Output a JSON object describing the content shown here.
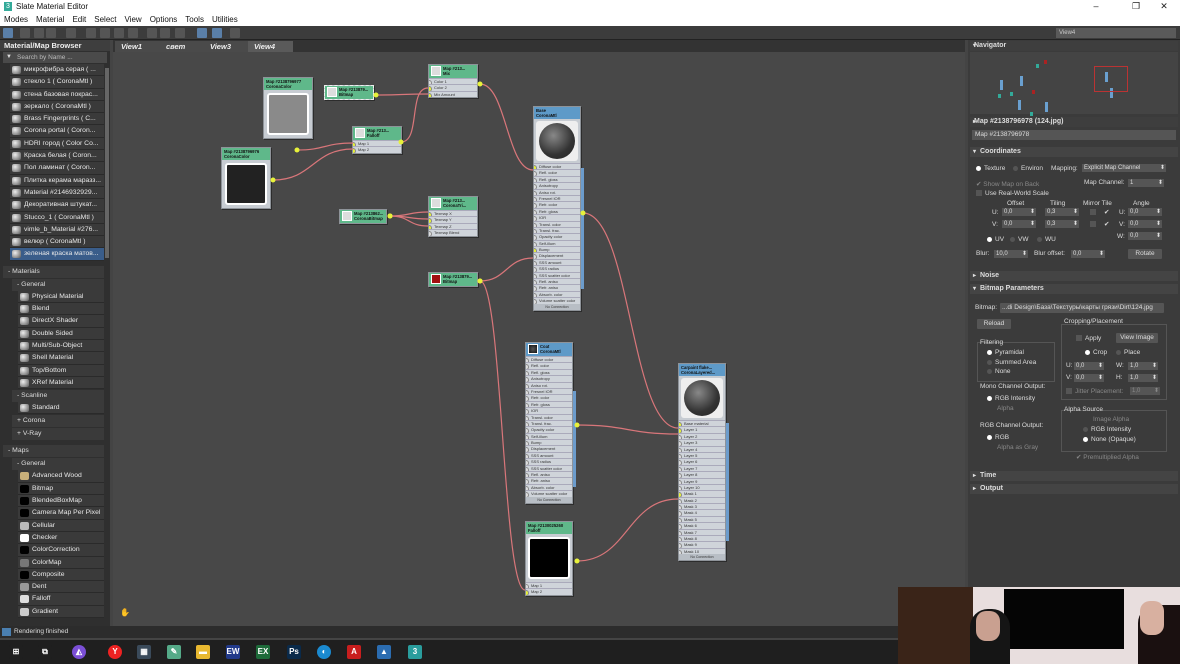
{
  "window": {
    "title": "Slate Material Editor",
    "controls": [
      "–",
      "❐",
      "✕"
    ]
  },
  "menu": [
    "Modes",
    "Material",
    "Edit",
    "Select",
    "View",
    "Options",
    "Tools",
    "Utilities"
  ],
  "view_selector": "View4",
  "browser": {
    "title": "Material/Map Browser",
    "search_placeholder": "Search by Name ...",
    "scene_materials": [
      "микрофибра серая ( ...",
      "стекло 1 ( CoronaMtl )",
      "стена базовая покрас...",
      "зеркало ( CoronaMtl )",
      "Brass Fingerprints ( C...",
      "Corona portal ( Coron...",
      "HDRI город ( Color Co...",
      "Краска белая ( Coron...",
      "Пол ламинат ( Coron...",
      "Плитка керама маразз...",
      "Material #2146932929...",
      "Декоративная штукат...",
      "Stucco_1 ( CoronaMtl )",
      "vimle_b_Material #276...",
      "велюр ( CoronaMtl )",
      "зеленая краска матов..."
    ],
    "selected_index": 15,
    "materials_label": "- Materials",
    "general_label": "- General",
    "general_materials": [
      "Physical Material",
      "Blend",
      "DirectX Shader",
      "Double Sided",
      "Multi/Sub-Object",
      "Shell Material",
      "Top/Bottom",
      "XRef Material"
    ],
    "scanline_label": "- Scanline",
    "scanline_items": [
      "Standard"
    ],
    "corona_label": "+ Corona",
    "vray_label": "+ V-Ray",
    "maps_label": "- Maps",
    "maps_general_label": "- General",
    "maps": [
      "Advanced Wood",
      "Bitmap",
      "BlendedBoxMap",
      "Camera Map Per Pixel",
      "Cellular",
      "Checker",
      "ColorCorrection",
      "ColorMap",
      "Composite",
      "Dent",
      "Falloff",
      "Gradient"
    ],
    "map_icon_colors": [
      "#c9b07a",
      "#000000",
      "#000000",
      "#000000",
      "#bbbbbb",
      "#ffffff",
      "#000000",
      "#777777",
      "#000000",
      "#999999",
      "#dddddd",
      "#cccccc"
    ]
  },
  "tabs": [
    "View1",
    "свет",
    "View3",
    "View4"
  ],
  "active_tab": 3,
  "nodes": [
    {
      "id": "n1",
      "title": "Map #2138796977",
      "type": "CoronaColor",
      "swatch": "#8a8a8a",
      "sockets": []
    },
    {
      "id": "n2",
      "title": "Map #2138796976",
      "type": "CoronaColor",
      "swatch": "#222222",
      "sockets": []
    },
    {
      "id": "n3",
      "title": "Map #213879...",
      "type": "Bitmap",
      "sockets": []
    },
    {
      "id": "n4",
      "title": "Map #213...",
      "type": "Falloff",
      "sockets": [
        "Map 1",
        "Map 2"
      ]
    },
    {
      "id": "n5",
      "title": "Map #213...",
      "type": "Mix",
      "sockets": [
        "Color 1",
        "Color 2",
        "Mix Amount"
      ]
    },
    {
      "id": "n6",
      "title": "Map #213862...",
      "type": "CoronaBitmap",
      "sockets": []
    },
    {
      "id": "n7",
      "title": "Map #213...",
      "type": "CoronaTri...",
      "sockets": [
        "Texmap X",
        "Texmap Y",
        "Texmap Z",
        "Texmap Blend"
      ]
    },
    {
      "id": "n8",
      "title": "Map #213879...",
      "type": "Bitmap",
      "sockets": []
    },
    {
      "id": "n9",
      "title": "Base",
      "type": "CoronaMtl",
      "sockets": [
        "Diffuse color",
        "Refl. color",
        "Refl. gloss",
        "Anisotropy",
        "Aniso rot.",
        "Fresnel IOR",
        "Refr. color",
        "Refr. gloss",
        "IOR",
        "Transl. color",
        "Transl. frac.",
        "Opacity color",
        "Self-illum",
        "Bump",
        "Displacement",
        "SSS amount",
        "SSS radius",
        "SSS scatter color",
        "Refl. aniso",
        "Refr. aniso",
        "Absorb. color",
        "Volume scatter color"
      ],
      "footer": "No Connection"
    },
    {
      "id": "n10",
      "title": "Coat",
      "type": "CoronaMtl",
      "sockets": [
        "Diffuse color",
        "Refl. color",
        "Refl. gloss",
        "Anisotropy",
        "Aniso rot.",
        "Fresnel IOR",
        "Refr. color",
        "Refr. gloss",
        "IOR",
        "Transl. color",
        "Transl. frac.",
        "Opacity color",
        "Self-illum",
        "Bump",
        "Displacement",
        "SSS amount",
        "SSS radius",
        "SSS scatter color",
        "Refl. aniso",
        "Refr. aniso",
        "Absorb. color",
        "Volume scatter color"
      ],
      "footer": "No Connection"
    },
    {
      "id": "n11",
      "title": "Map #2130025260",
      "type": "Falloff",
      "swatch": "#000000",
      "sockets": [
        "Map 1",
        "Map 2"
      ]
    },
    {
      "id": "n12",
      "title": "Carpaint flake...",
      "type": "CoronaLayered...",
      "sockets": [
        "Base material",
        "Layer 1",
        "Layer 2",
        "Layer 3",
        "Layer 4",
        "Layer 5",
        "Layer 6",
        "Layer 7",
        "Layer 8",
        "Layer 9",
        "Layer 10",
        "Mask 1",
        "Mask 2",
        "Mask 3",
        "Mask 4",
        "Mask 5",
        "Mask 6",
        "Mask 7",
        "Mask 8",
        "Mask 9",
        "Mask 10"
      ],
      "footer": "No Connection"
    }
  ],
  "navigator": {
    "title": "Navigator"
  },
  "params": {
    "title": "Map #2138796978 (124.jpg)",
    "name_field": "Map #2138796978",
    "coordinates": {
      "label": "Coordinates",
      "texture": "Texture",
      "environ": "Environ",
      "mapping_label": "Mapping:",
      "mapping": "Explicit Map Channel",
      "show_map_on_back": "Show Map on Back",
      "map_channel_label": "Map Channel:",
      "map_channel": "1",
      "real_world": "Use Real-World Scale",
      "offset": "Offset",
      "tiling": "Tiling",
      "mirror_tile": "Mirror Tile",
      "angle": "Angle",
      "u_label": "U:",
      "v_label": "V:",
      "w_label": "W:",
      "u_offset": "0,0",
      "v_offset": "0,0",
      "u_tiling": "0,3",
      "v_tiling": "0,3",
      "u_angle": "0,0",
      "v_angle": "0,0",
      "w_angle": "0,0",
      "uv": "UV",
      "vw": "VW",
      "wu": "WU",
      "blur_label": "Blur:",
      "blur": "10,0",
      "blur_offset_label": "Blur offset:",
      "blur_offset": "0,0",
      "rotate": "Rotate"
    },
    "noise": "Noise",
    "bitmap": {
      "label": "Bitmap Parameters",
      "bitmap_label": "Bitmap:",
      "path": "...di Design\\База\\Текстуры\\карты грязи\\Dirt\\124.jpg",
      "reload": "Reload",
      "cropping": "Cropping/Placement",
      "apply": "Apply",
      "view_image": "View Image",
      "crop": "Crop",
      "place": "Place",
      "u": "0,0",
      "v": "0,0",
      "w": "1,0",
      "h": "1,0",
      "w_label": "W:",
      "h_label": "H:",
      "jitter": "Jitter Placement:",
      "jitter_val": "1,0",
      "filtering": "Filtering",
      "pyramidal": "Pyramidal",
      "summed": "Summed Area",
      "none": "None",
      "mono": "Mono Channel Output:",
      "rgb_intensity": "RGB Intensity",
      "alpha": "Alpha",
      "rgb_out": "RGB Channel Output:",
      "rgb": "RGB",
      "alpha_gray": "Alpha as Gray",
      "alpha_source": "Alpha Source",
      "image_alpha": "Image Alpha",
      "as_rgb_intensity": "RGB Intensity",
      "none_opaque": "None (Opaque)",
      "premult": "Premultiplied Alpha"
    },
    "time": "Time",
    "output": "Output"
  },
  "status": "Rendering finished",
  "taskbar": [
    {
      "name": "start",
      "glyph": "⊞",
      "color": "#1f1f1f"
    },
    {
      "name": "task-view",
      "glyph": "⧉",
      "color": "#1f1f1f"
    },
    {
      "name": "alice",
      "glyph": "◭",
      "color": "#7b4fd6"
    },
    {
      "name": "yandex",
      "glyph": "Y",
      "color": "#e22"
    },
    {
      "name": "calculator",
      "glyph": "▦",
      "color": "#3a4a5a"
    },
    {
      "name": "paint",
      "glyph": "✎",
      "color": "#5a8"
    },
    {
      "name": "explorer",
      "glyph": "▬",
      "color": "#e8b830"
    },
    {
      "name": "ew",
      "glyph": "EW",
      "color": "#223a8a"
    },
    {
      "name": "excel",
      "glyph": "EX",
      "color": "#1e6b3a"
    },
    {
      "name": "photoshop",
      "glyph": "Ps",
      "color": "#0a2a4a"
    },
    {
      "name": "edge",
      "glyph": "◐",
      "color": "#1b8ad0"
    },
    {
      "name": "autocad",
      "glyph": "A",
      "color": "#c81e1e"
    },
    {
      "name": "photos",
      "glyph": "▲",
      "color": "#2b6cb0"
    },
    {
      "name": "3ds-max",
      "glyph": "3",
      "color": "#2a9d9d"
    }
  ]
}
